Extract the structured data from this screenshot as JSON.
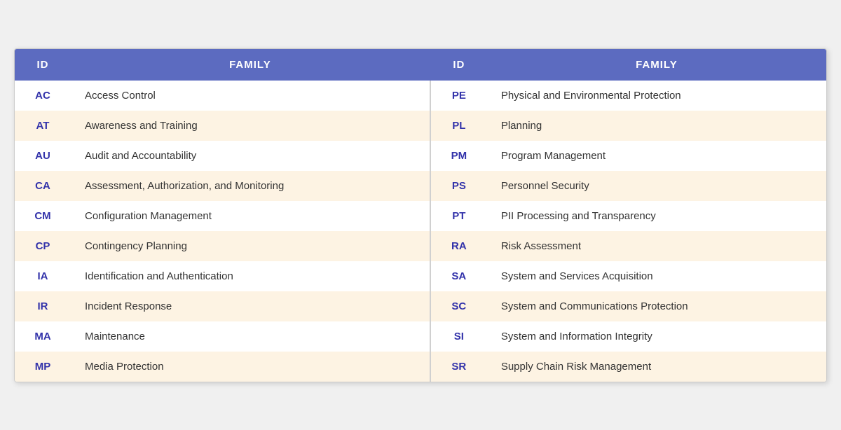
{
  "header": {
    "col1_id": "ID",
    "col1_family": "FAMILY",
    "col2_id": "ID",
    "col2_family": "FAMILY"
  },
  "rows": [
    {
      "id1": "AC",
      "family1": "Access Control",
      "id2": "PE",
      "family2": "Physical and Environmental Protection"
    },
    {
      "id1": "AT",
      "family1": "Awareness and Training",
      "id2": "PL",
      "family2": "Planning"
    },
    {
      "id1": "AU",
      "family1": "Audit and Accountability",
      "id2": "PM",
      "family2": "Program Management"
    },
    {
      "id1": "CA",
      "family1": "Assessment, Authorization, and Monitoring",
      "id2": "PS",
      "family2": "Personnel Security"
    },
    {
      "id1": "CM",
      "family1": "Configuration Management",
      "id2": "PT",
      "family2": "PII Processing and Transparency"
    },
    {
      "id1": "CP",
      "family1": "Contingency Planning",
      "id2": "RA",
      "family2": "Risk Assessment"
    },
    {
      "id1": "IA",
      "family1": "Identification and Authentication",
      "id2": "SA",
      "family2": "System and Services Acquisition"
    },
    {
      "id1": "IR",
      "family1": "Incident Response",
      "id2": "SC",
      "family2": "System and Communications Protection"
    },
    {
      "id1": "MA",
      "family1": "Maintenance",
      "id2": "SI",
      "family2": "System and Information Integrity"
    },
    {
      "id1": "MP",
      "family1": "Media Protection",
      "id2": "SR",
      "family2": "Supply Chain Risk Management"
    }
  ]
}
